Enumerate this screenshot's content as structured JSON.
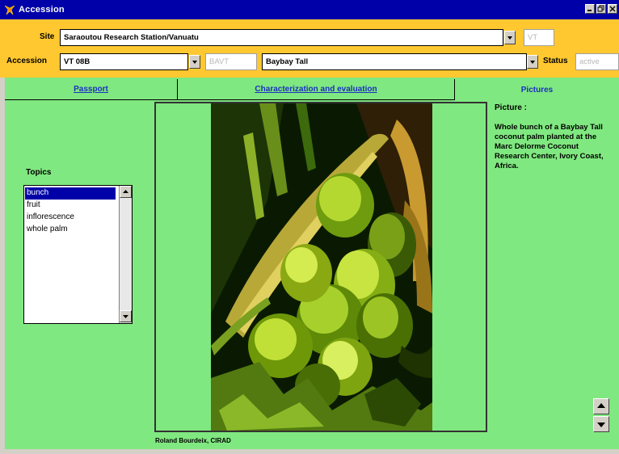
{
  "window": {
    "title": "Accession",
    "controls": [
      "minimize",
      "restore",
      "close"
    ]
  },
  "header": {
    "site_label": "Site",
    "site_value": "Saraoutou Research Station/Vanuatu",
    "site_code": "VT",
    "accession_label": "Accession",
    "accession_value": "VT 08B",
    "accession_code_placeholder": "BAVT",
    "accession_name": "Baybay Tall",
    "status_label": "Status",
    "status_value": "active"
  },
  "tabs": [
    {
      "label": "Passport",
      "active": false
    },
    {
      "label": "Characterization and evaluation",
      "active": false
    },
    {
      "label": "Pictures",
      "active": true
    }
  ],
  "topics": {
    "label": "Topics",
    "items": [
      "bunch",
      "fruit",
      "inflorescence",
      "whole palm"
    ],
    "selected": "bunch"
  },
  "picture": {
    "credit": "Roland Bourdeix, CIRAD",
    "heading": "Picture :",
    "description": "Whole bunch of a Baybay Tall coconut palm planted at the Marc Delorme Coconut Research Center, Ivory Coast, Africa."
  },
  "colors": {
    "titlebar": "#0000a8",
    "header_bg": "#ffc830",
    "content_bg": "#80e880",
    "tab_link": "#1a30c0",
    "selection": "#0000a8"
  },
  "icons": {
    "app": "app-icon",
    "dropdown": "chevron-down-icon",
    "scroll_up": "arrow-up-icon",
    "scroll_down": "arrow-down-icon",
    "prev": "arrow-up-icon",
    "next": "arrow-down-icon"
  }
}
